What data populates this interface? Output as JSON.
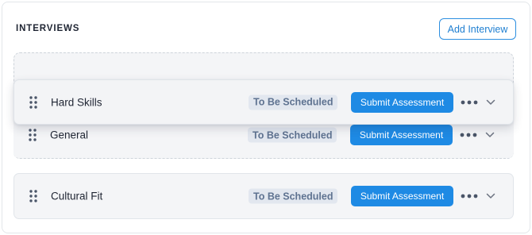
{
  "section": {
    "title": "INTERVIEWS",
    "add_button_label": "Add Interview"
  },
  "interviews": [
    {
      "name": "Hard Skills",
      "status": "To Be Scheduled",
      "action_label": "Submit Assessment",
      "state": "dragging"
    },
    {
      "name": "General",
      "status": "To Be Scheduled",
      "action_label": "Submit Assessment",
      "state": "in-drop-zone"
    },
    {
      "name": "Cultural Fit",
      "status": "To Be Scheduled",
      "action_label": "Submit Assessment",
      "state": "normal"
    }
  ],
  "icons": {
    "drag_handle": "drag-handle-icon",
    "more": "more-horizontal-icon",
    "expand": "chevron-down-icon"
  },
  "colors": {
    "accent": "#1e8ae4",
    "status_bg": "#e2e7ef",
    "status_text": "#5f7391",
    "row_bg": "#f4f5f7"
  }
}
